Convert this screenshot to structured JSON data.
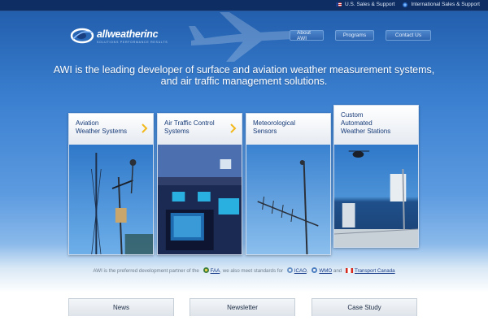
{
  "topbar": {
    "links": [
      {
        "label": "U.S. Sales & Support",
        "icon": "us-flag-icon"
      },
      {
        "label": "International Sales & Support",
        "icon": "globe-icon"
      }
    ]
  },
  "logo": {
    "name": "allweatherinc",
    "tagline": "SOLUTIONS PERFORMANCE RESULTS"
  },
  "nav": {
    "items": [
      "About AWI",
      "Programs",
      "Contact Us"
    ]
  },
  "headline": "AWI is the leading developer of surface and aviation weather measurement systems, and air traffic management solutions.",
  "cards": [
    {
      "line1": "Aviation",
      "line2": "Weather Systems",
      "line3": "",
      "has_chevron": true
    },
    {
      "line1": "Air Traffic Control",
      "line2": "Systems",
      "line3": "",
      "has_chevron": true
    },
    {
      "line1": "Meteorological",
      "line2": "Sensors",
      "line3": "",
      "has_chevron": false
    },
    {
      "line1": "Custom",
      "line2": "Automated",
      "line3": "Weather Stations",
      "has_chevron": false
    }
  ],
  "partners": {
    "prefix": "AWI is the preferred development partner of the",
    "faa": "FAA",
    "middle": ", we also meet standards for",
    "icao": "ICAO",
    "comma": ",",
    "wmo": "WMO",
    "and": "and",
    "canada": "Transport Canada"
  },
  "bottom_tabs": [
    "News",
    "Newsletter",
    "Case Study"
  ],
  "colors": {
    "accent": "#f3b81c",
    "brand_dark": "#0d2d63",
    "card_title": "#173b78"
  }
}
